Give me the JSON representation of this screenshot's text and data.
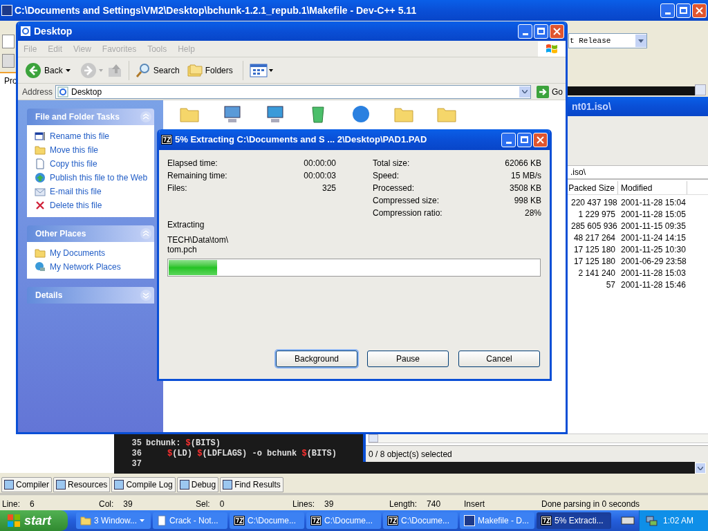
{
  "devcpp": {
    "title": "C:\\Documents and Settings\\VM2\\Desktop\\bchunk-1.2.1_repub.1\\Makefile - Dev-C++ 5.11",
    "side_tab": "Pro",
    "build_config": "t Release",
    "code_lines": [
      {
        "number": "35",
        "indented": false,
        "tokens": [
          {
            "kind": "plain",
            "text": "bchunk: "
          },
          {
            "kind": "var",
            "text": "$"
          },
          {
            "kind": "plain",
            "text": "(BITS)"
          }
        ]
      },
      {
        "number": "36",
        "indented": true,
        "tokens": [
          {
            "kind": "var",
            "text": "$"
          },
          {
            "kind": "plain",
            "text": "(LD) "
          },
          {
            "kind": "var",
            "text": "$"
          },
          {
            "kind": "plain",
            "text": "(LDFLAGS) -o bchunk "
          },
          {
            "kind": "var",
            "text": "$"
          },
          {
            "kind": "plain",
            "text": "(BITS)"
          }
        ]
      },
      {
        "number": "37"
      }
    ],
    "bottom_tabs": [
      "Compiler",
      "Resources",
      "Compile Log",
      "Debug",
      "Find Results"
    ],
    "status_fields": [
      {
        "label": "Line:",
        "value": "6"
      },
      {
        "label": "Col:",
        "value": "39"
      },
      {
        "label": "Sel:",
        "value": "0"
      },
      {
        "label": "Lines:",
        "value": "39"
      },
      {
        "label": "Length:",
        "value": "740"
      }
    ],
    "status_texts": [
      "Insert",
      "Done parsing in 0 seconds"
    ]
  },
  "archive_window": {
    "title": "nt01.iso\\",
    "path": ".iso\\",
    "columns": [
      "Packed Size",
      "Modified"
    ],
    "rows": [
      [
        "220 437 198",
        "2001-11-28 15:04"
      ],
      [
        "1 229 975",
        "2001-11-28 15:05"
      ],
      [
        "285 605 936",
        "2001-11-15 09:35"
      ],
      [
        "48 217 264",
        "2001-11-24 14:15"
      ],
      [
        "17 125 180",
        "2001-11-25 10:30"
      ],
      [
        "17 125 180",
        "2001-06-29 23:58"
      ],
      [
        "2 141 240",
        "2001-11-28 15:03"
      ],
      [
        "57",
        "2001-11-28 15:46"
      ]
    ],
    "status": "0 / 8 object(s) selected"
  },
  "explorer": {
    "title": "Desktop",
    "menu": [
      "File",
      "Edit",
      "View",
      "Favorites",
      "Tools",
      "Help"
    ],
    "back": "Back",
    "search": "Search",
    "folders": "Folders",
    "address_label": "Address",
    "address": "Desktop",
    "go": "Go",
    "panels": [
      {
        "title": "File and Folder Tasks",
        "expanded": true,
        "items": [
          "Rename this file",
          "Move this file",
          "Copy this file",
          "Publish this file to the Web",
          "E-mail this file",
          "Delete this file"
        ]
      },
      {
        "title": "Other Places",
        "expanded": true,
        "items": [
          "My Documents",
          "My Network Places"
        ]
      },
      {
        "title": "Details",
        "expanded": false
      }
    ]
  },
  "progress_dialog": {
    "title": "5% Extracting C:\\Documents and S ... 2\\Desktop\\PAD1.PAD",
    "left_stats": [
      {
        "label": "Elapsed time:",
        "value": "00:00:00"
      },
      {
        "label": "Remaining time:",
        "value": "00:00:03"
      },
      {
        "label": "Files:",
        "value": "325"
      }
    ],
    "right_stats": [
      {
        "label": "Total size:",
        "value": "62066 KB"
      },
      {
        "label": "Speed:",
        "value": "15 MB/s"
      },
      {
        "label": "Processed:",
        "value": "3508 KB"
      },
      {
        "label": "Compressed size:",
        "value": "998 KB"
      },
      {
        "label": "Compression ratio:",
        "value": "28%"
      }
    ],
    "status": "Extracting",
    "current_path": "TECH\\Data\\tom\\",
    "current_file": "tom.pch",
    "level": 0.13,
    "buttons": [
      {
        "label": "Background",
        "focused": true
      },
      {
        "label": "Pause",
        "focused": false
      },
      {
        "label": "Cancel",
        "focused": false
      }
    ]
  },
  "taskbar": {
    "start": "start",
    "buttons": [
      {
        "label": "3 Window...",
        "kind": "group",
        "selected": false
      },
      {
        "label": "Crack - Not...",
        "kind": "notepad",
        "selected": false
      },
      {
        "label": "C:\\Docume...",
        "kind": "zip",
        "selected": false
      },
      {
        "label": "C:\\Docume...",
        "kind": "zip",
        "selected": false
      },
      {
        "label": "C:\\Docume...",
        "kind": "zip",
        "selected": false
      },
      {
        "label": "Makefile - D...",
        "kind": "devcpp",
        "selected": false
      },
      {
        "label": "5% Extracti...",
        "kind": "zip",
        "selected": true
      }
    ],
    "clock": "1:02 AM"
  }
}
